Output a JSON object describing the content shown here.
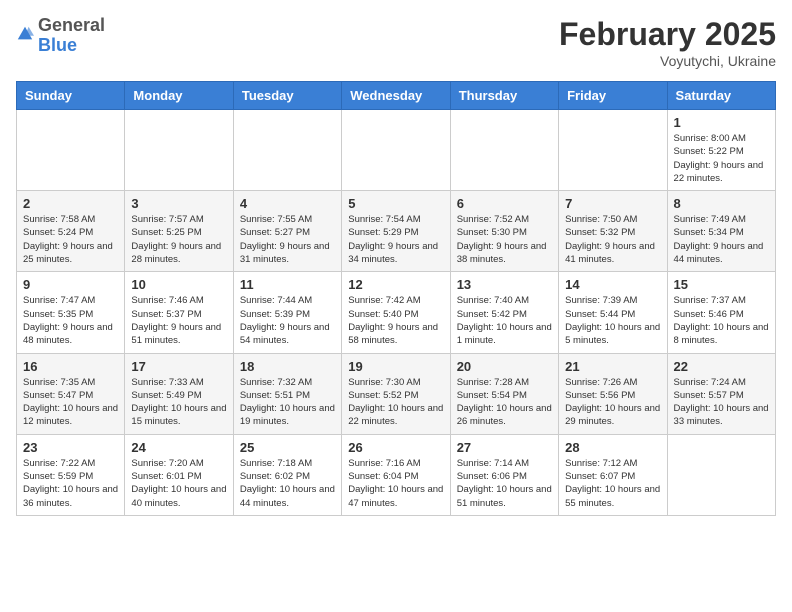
{
  "header": {
    "logo_general": "General",
    "logo_blue": "Blue",
    "month_title": "February 2025",
    "location": "Voyutychi, Ukraine"
  },
  "weekdays": [
    "Sunday",
    "Monday",
    "Tuesday",
    "Wednesday",
    "Thursday",
    "Friday",
    "Saturday"
  ],
  "weeks": [
    [
      {
        "day": "",
        "info": ""
      },
      {
        "day": "",
        "info": ""
      },
      {
        "day": "",
        "info": ""
      },
      {
        "day": "",
        "info": ""
      },
      {
        "day": "",
        "info": ""
      },
      {
        "day": "",
        "info": ""
      },
      {
        "day": "1",
        "info": "Sunrise: 8:00 AM\nSunset: 5:22 PM\nDaylight: 9 hours and 22 minutes."
      }
    ],
    [
      {
        "day": "2",
        "info": "Sunrise: 7:58 AM\nSunset: 5:24 PM\nDaylight: 9 hours and 25 minutes."
      },
      {
        "day": "3",
        "info": "Sunrise: 7:57 AM\nSunset: 5:25 PM\nDaylight: 9 hours and 28 minutes."
      },
      {
        "day": "4",
        "info": "Sunrise: 7:55 AM\nSunset: 5:27 PM\nDaylight: 9 hours and 31 minutes."
      },
      {
        "day": "5",
        "info": "Sunrise: 7:54 AM\nSunset: 5:29 PM\nDaylight: 9 hours and 34 minutes."
      },
      {
        "day": "6",
        "info": "Sunrise: 7:52 AM\nSunset: 5:30 PM\nDaylight: 9 hours and 38 minutes."
      },
      {
        "day": "7",
        "info": "Sunrise: 7:50 AM\nSunset: 5:32 PM\nDaylight: 9 hours and 41 minutes."
      },
      {
        "day": "8",
        "info": "Sunrise: 7:49 AM\nSunset: 5:34 PM\nDaylight: 9 hours and 44 minutes."
      }
    ],
    [
      {
        "day": "9",
        "info": "Sunrise: 7:47 AM\nSunset: 5:35 PM\nDaylight: 9 hours and 48 minutes."
      },
      {
        "day": "10",
        "info": "Sunrise: 7:46 AM\nSunset: 5:37 PM\nDaylight: 9 hours and 51 minutes."
      },
      {
        "day": "11",
        "info": "Sunrise: 7:44 AM\nSunset: 5:39 PM\nDaylight: 9 hours and 54 minutes."
      },
      {
        "day": "12",
        "info": "Sunrise: 7:42 AM\nSunset: 5:40 PM\nDaylight: 9 hours and 58 minutes."
      },
      {
        "day": "13",
        "info": "Sunrise: 7:40 AM\nSunset: 5:42 PM\nDaylight: 10 hours and 1 minute."
      },
      {
        "day": "14",
        "info": "Sunrise: 7:39 AM\nSunset: 5:44 PM\nDaylight: 10 hours and 5 minutes."
      },
      {
        "day": "15",
        "info": "Sunrise: 7:37 AM\nSunset: 5:46 PM\nDaylight: 10 hours and 8 minutes."
      }
    ],
    [
      {
        "day": "16",
        "info": "Sunrise: 7:35 AM\nSunset: 5:47 PM\nDaylight: 10 hours and 12 minutes."
      },
      {
        "day": "17",
        "info": "Sunrise: 7:33 AM\nSunset: 5:49 PM\nDaylight: 10 hours and 15 minutes."
      },
      {
        "day": "18",
        "info": "Sunrise: 7:32 AM\nSunset: 5:51 PM\nDaylight: 10 hours and 19 minutes."
      },
      {
        "day": "19",
        "info": "Sunrise: 7:30 AM\nSunset: 5:52 PM\nDaylight: 10 hours and 22 minutes."
      },
      {
        "day": "20",
        "info": "Sunrise: 7:28 AM\nSunset: 5:54 PM\nDaylight: 10 hours and 26 minutes."
      },
      {
        "day": "21",
        "info": "Sunrise: 7:26 AM\nSunset: 5:56 PM\nDaylight: 10 hours and 29 minutes."
      },
      {
        "day": "22",
        "info": "Sunrise: 7:24 AM\nSunset: 5:57 PM\nDaylight: 10 hours and 33 minutes."
      }
    ],
    [
      {
        "day": "23",
        "info": "Sunrise: 7:22 AM\nSunset: 5:59 PM\nDaylight: 10 hours and 36 minutes."
      },
      {
        "day": "24",
        "info": "Sunrise: 7:20 AM\nSunset: 6:01 PM\nDaylight: 10 hours and 40 minutes."
      },
      {
        "day": "25",
        "info": "Sunrise: 7:18 AM\nSunset: 6:02 PM\nDaylight: 10 hours and 44 minutes."
      },
      {
        "day": "26",
        "info": "Sunrise: 7:16 AM\nSunset: 6:04 PM\nDaylight: 10 hours and 47 minutes."
      },
      {
        "day": "27",
        "info": "Sunrise: 7:14 AM\nSunset: 6:06 PM\nDaylight: 10 hours and 51 minutes."
      },
      {
        "day": "28",
        "info": "Sunrise: 7:12 AM\nSunset: 6:07 PM\nDaylight: 10 hours and 55 minutes."
      },
      {
        "day": "",
        "info": ""
      }
    ]
  ]
}
